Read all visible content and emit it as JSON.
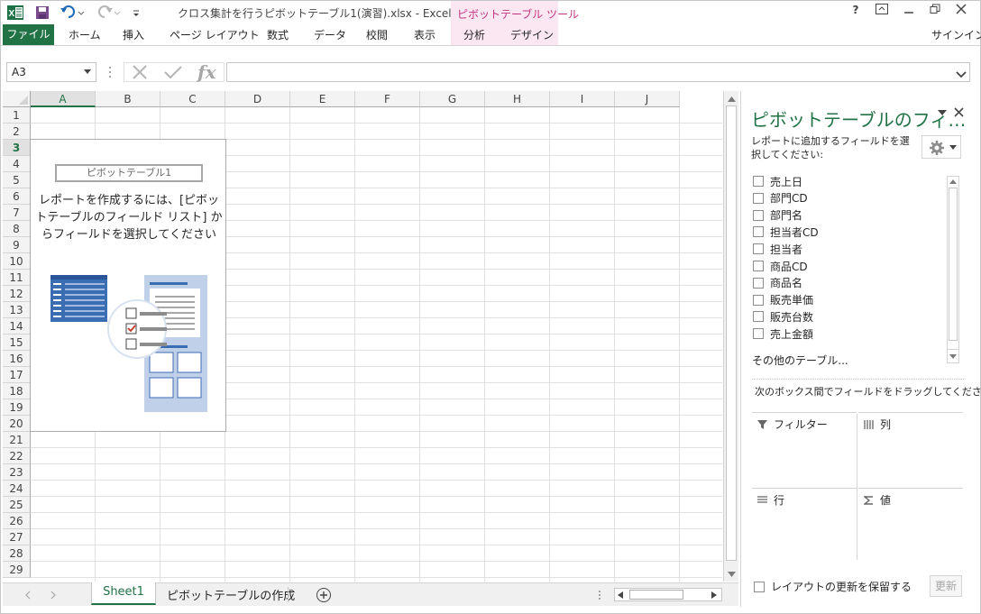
{
  "app": {
    "title": "クロス集計を行うピボットテーブル1(演習).xlsx - Excel",
    "context_tab_group": "ピボットテーブル ツール",
    "sign_in": "サインイン",
    "help": "?",
    "accent": "#217346",
    "context_accent": "#c0347e"
  },
  "quick_access": {
    "icons": [
      "excel-logo-icon",
      "save-icon",
      "undo-icon",
      "redo-icon",
      "customize-qat-icon"
    ]
  },
  "ribbon": {
    "file": "ファイル",
    "tabs": [
      "ホーム",
      "挿入",
      "ページ レイアウト",
      "数式",
      "データ",
      "校閲",
      "表示"
    ],
    "context_tabs": [
      "分析",
      "デザイン"
    ]
  },
  "formula_bar": {
    "name_box": "A3",
    "fx": "fx",
    "value": ""
  },
  "grid": {
    "columns": [
      "A",
      "B",
      "C",
      "D",
      "E",
      "F",
      "G",
      "H",
      "I",
      "J"
    ],
    "rows": [
      "1",
      "2",
      "3",
      "4",
      "5",
      "6",
      "7",
      "8",
      "9",
      "10",
      "11",
      "12",
      "13",
      "14",
      "15",
      "16",
      "17",
      "18",
      "19",
      "20",
      "21",
      "22",
      "23",
      "24",
      "25",
      "26",
      "27",
      "28",
      "29"
    ],
    "active_cell": "A3"
  },
  "pivot_placeholder": {
    "name": "ピボットテーブル1",
    "instructions": "レポートを作成するには、[ピボットテーブルのフィールド リスト] からフィールドを選択してください"
  },
  "sheets": {
    "tabs": [
      "Sheet1",
      "ピボットテーブルの作成"
    ],
    "active": "Sheet1"
  },
  "field_pane": {
    "title": "ピボットテーブルのフィ…",
    "subtitle": "レポートに追加するフィールドを選択してください:",
    "fields": [
      "売上日",
      "部門CD",
      "部門名",
      "担当者CD",
      "担当者",
      "商品CD",
      "商品名",
      "販売単価",
      "販売台数",
      "売上金額"
    ],
    "more_tables": "その他のテーブル...",
    "drag_hint": "次のボックス間でフィールドをドラッグしてください:",
    "areas": {
      "filter": "フィルター",
      "columns": "列",
      "rows": "行",
      "values": "値"
    },
    "defer_update": "レイアウトの更新を保留する",
    "update_button": "更新"
  }
}
